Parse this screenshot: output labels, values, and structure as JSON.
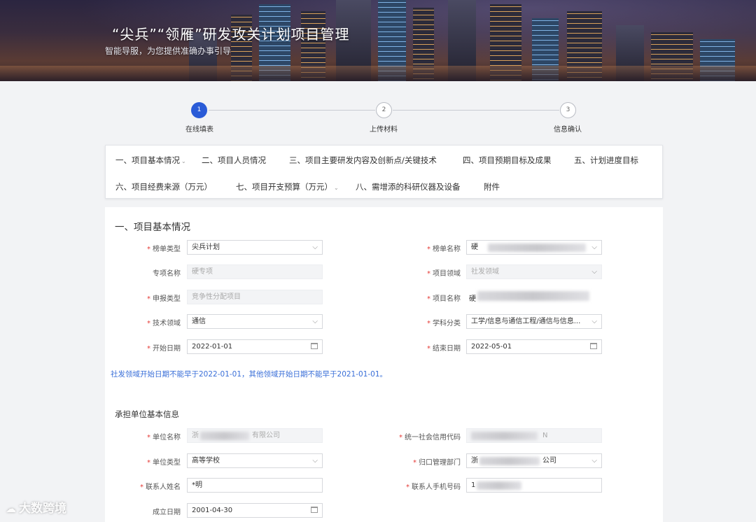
{
  "banner": {
    "title": "“尖兵”“领雁”研发攻关计划项目管理",
    "subtitle": "智能导服，为您提供准确办事引导"
  },
  "steps": [
    {
      "number": "1",
      "label": "在线填表",
      "active": true
    },
    {
      "number": "2",
      "label": "上传材料",
      "active": false
    },
    {
      "number": "3",
      "label": "信息确认",
      "active": false
    }
  ],
  "nav": {
    "items": [
      "一、项目基本情况",
      "二、项目人员情况",
      "三、项目主要研发内容及创新点/关键技术",
      "四、项目预期目标及成果",
      "五、计划进度目标",
      "六、项目经费来源（万元）",
      "七、项目开支预算（万元）",
      "八、需增添的科研仪器及设备",
      "附件"
    ]
  },
  "form": {
    "section_title": "一、项目基本情况",
    "fields": {
      "bangdan_type": {
        "label": "榜单类型",
        "value": "尖兵计划"
      },
      "bangdan_name": {
        "label": "榜单名称",
        "value": "硬"
      },
      "special_name": {
        "label": "专项名称",
        "value": "硬专项"
      },
      "project_domain": {
        "label": "项目领域",
        "value": "社发领域"
      },
      "apply_type": {
        "label": "申报类型",
        "value": "竞争性分配项目"
      },
      "project_name": {
        "label": "项目名称",
        "value": "硬"
      },
      "tech_domain": {
        "label": "技术领域",
        "value": "通信"
      },
      "subject": {
        "label": "学科分类",
        "value": "工学/信息与通信工程/通信与信息..."
      },
      "start_date": {
        "label": "开始日期",
        "value": "2022-01-01"
      },
      "end_date": {
        "label": "结束日期",
        "value": "2022-05-01"
      }
    },
    "note": "社发领域开始日期不能早于2022-01-01，其他领域开始日期不能早于2021-01-01。",
    "org_title": "承担单位基本信息",
    "org_fields": {
      "org_name": {
        "label": "单位名称",
        "value": "浙",
        "suffix": "有限公司"
      },
      "credit_code": {
        "label": "统一社会信用代码",
        "value": "N"
      },
      "org_type": {
        "label": "单位类型",
        "value": "高等学校"
      },
      "dept": {
        "label": "归口管理部门",
        "value": "浙",
        "suffix": "公司"
      },
      "contact_name": {
        "label": "联系人姓名",
        "value": "*明"
      },
      "contact_phone": {
        "label": "联系人手机号码",
        "value": "1"
      },
      "founded": {
        "label": "成立日期",
        "value": "2001-04-30"
      }
    }
  },
  "watermark": "大数跨境"
}
